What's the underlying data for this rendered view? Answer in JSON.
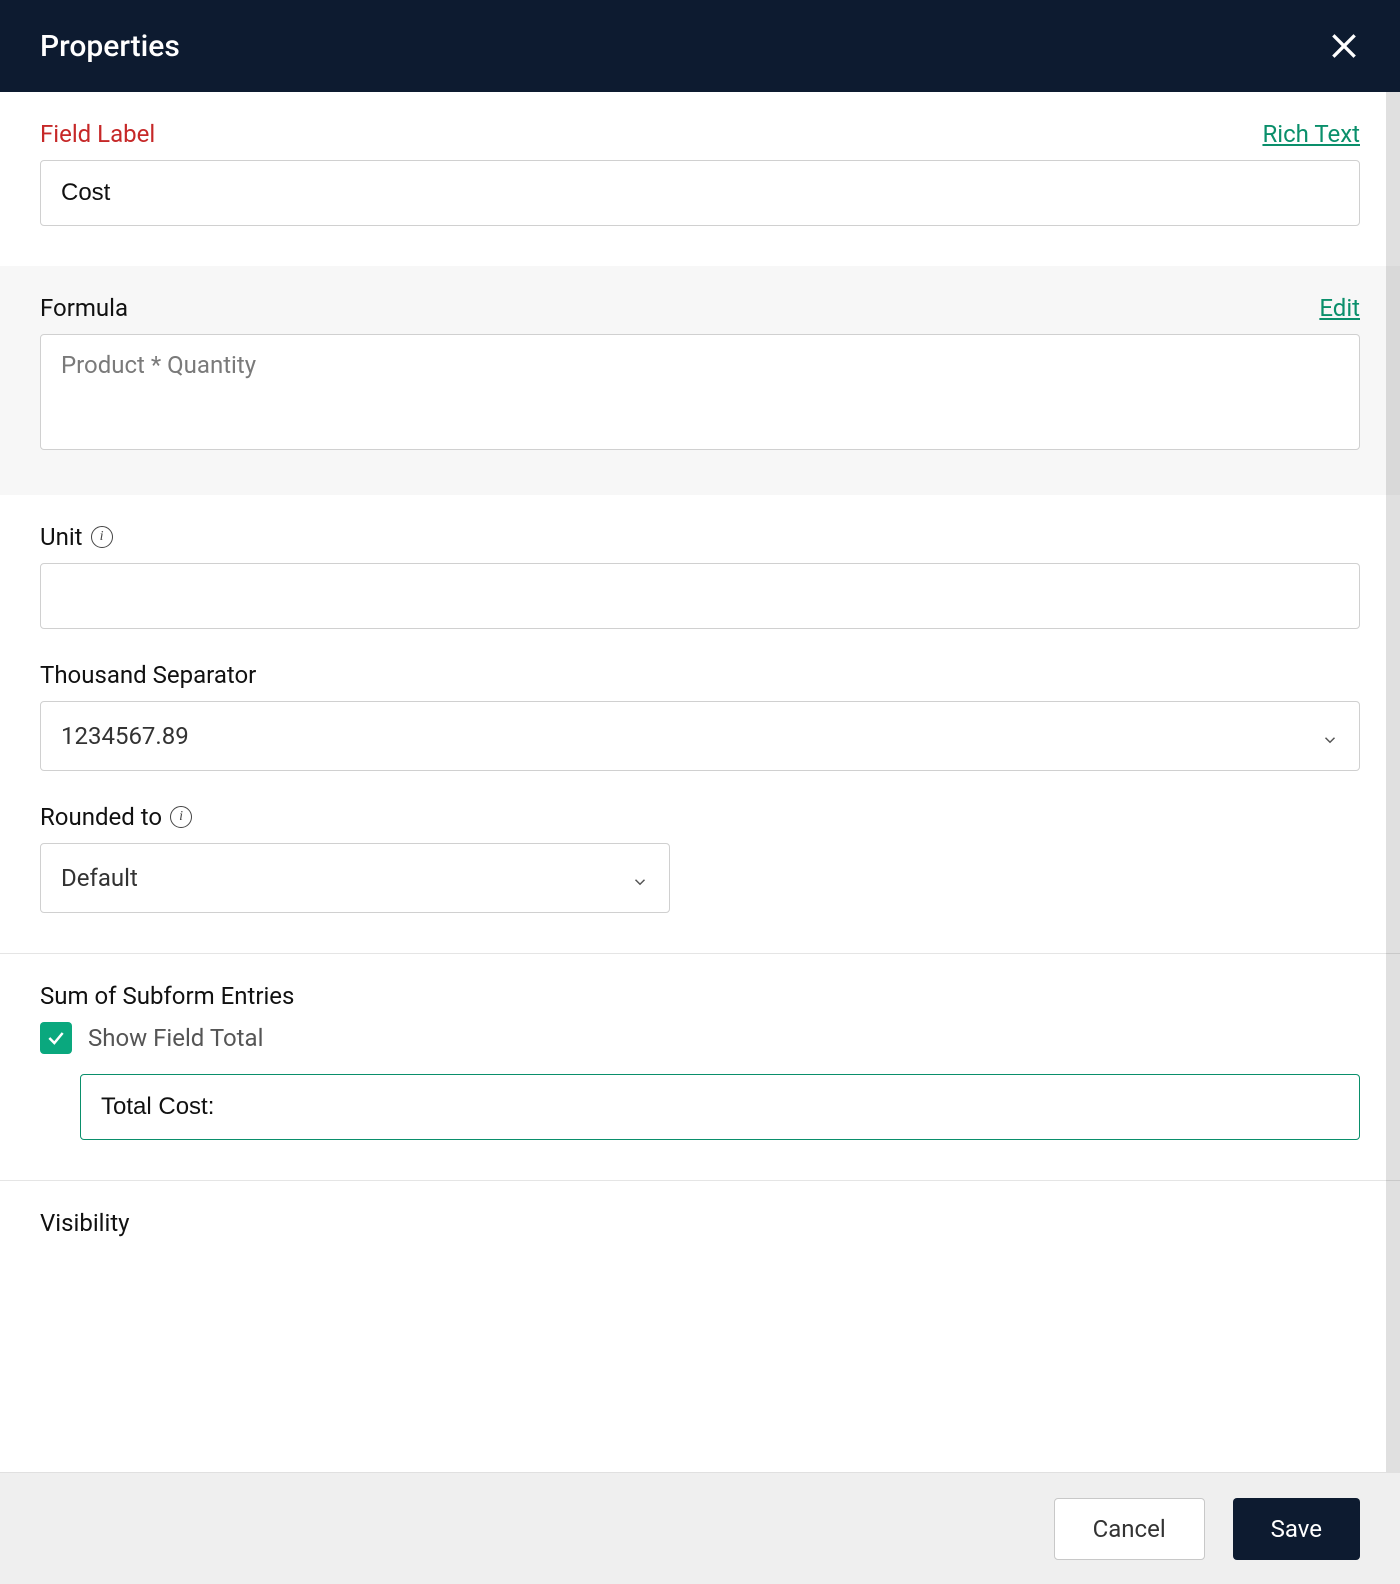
{
  "header": {
    "title": "Properties",
    "close_label": "Close"
  },
  "fieldLabel": {
    "label": "Field Label",
    "richText": "Rich Text",
    "value": "Cost"
  },
  "formula": {
    "label": "Formula",
    "editLabel": "Edit",
    "value": "Product * Quantity"
  },
  "unit": {
    "label": "Unit",
    "value": ""
  },
  "thousandSeparator": {
    "label": "Thousand Separator",
    "value": "1234567.89"
  },
  "roundedTo": {
    "label": "Rounded to",
    "value": "Default"
  },
  "sumSubform": {
    "label": "Sum of Subform Entries",
    "checkboxLabel": "Show Field Total",
    "checked": true,
    "totalValue": "Total Cost:"
  },
  "visibility": {
    "label": "Visibility"
  },
  "footer": {
    "cancel": "Cancel",
    "save": "Save"
  }
}
